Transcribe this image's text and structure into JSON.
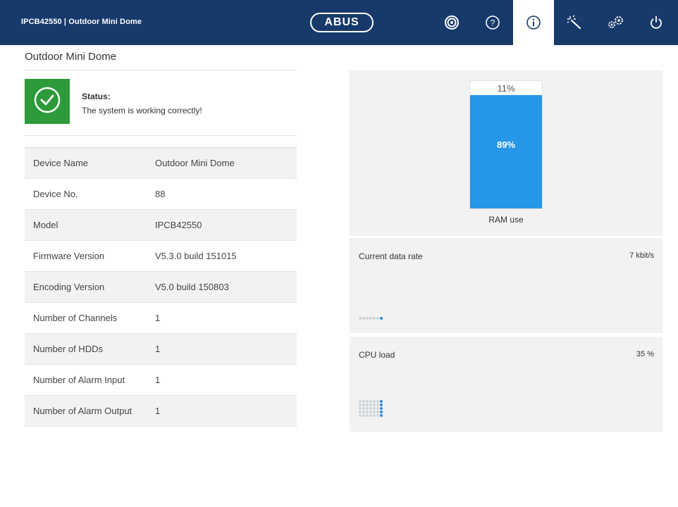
{
  "header": {
    "title": "IPCB42550 | Outdoor Mini Dome",
    "logo": "ABUS",
    "nav": [
      {
        "name": "live-view-nav",
        "icon": "camera-lens-icon",
        "active": false
      },
      {
        "name": "help-nav",
        "icon": "help-icon",
        "active": false
      },
      {
        "name": "info-nav",
        "icon": "info-icon",
        "active": true
      },
      {
        "name": "wizard-nav",
        "icon": "magic-wand-icon",
        "active": false
      },
      {
        "name": "settings-nav",
        "icon": "gears-icon",
        "active": false
      },
      {
        "name": "logout-nav",
        "icon": "power-icon",
        "active": false
      }
    ]
  },
  "page": {
    "title": "Outdoor Mini Dome",
    "status": {
      "heading": "Status:",
      "message": "The system is working correctly!",
      "icon": "check-circle-icon",
      "color": "#2e9a3c"
    },
    "info": [
      {
        "key": "Device Name",
        "value": "Outdoor Mini Dome"
      },
      {
        "key": "Device No.",
        "value": "88"
      },
      {
        "key": "Model",
        "value": "IPCB42550"
      },
      {
        "key": "Firmware Version",
        "value": "V5.3.0 build 151015"
      },
      {
        "key": "Encoding Version",
        "value": "V5.0 build 150803"
      },
      {
        "key": "Number of Channels",
        "value": "1"
      },
      {
        "key": "Number of HDDs",
        "value": "1"
      },
      {
        "key": "Number of Alarm Input",
        "value": "1"
      },
      {
        "key": "Number of Alarm Output",
        "value": "1"
      }
    ]
  },
  "ram": {
    "free_label": "11%",
    "used_label": "89%",
    "used_fraction": 0.89,
    "caption": "RAM use",
    "color": "#2797e8"
  },
  "data_rate": {
    "label": "Current data rate",
    "value": "7 kbit/s"
  },
  "cpu": {
    "label": "CPU load",
    "value": "35 %"
  },
  "colors": {
    "header_bg": "#173a6b",
    "accent_blue": "#2e86d6"
  }
}
